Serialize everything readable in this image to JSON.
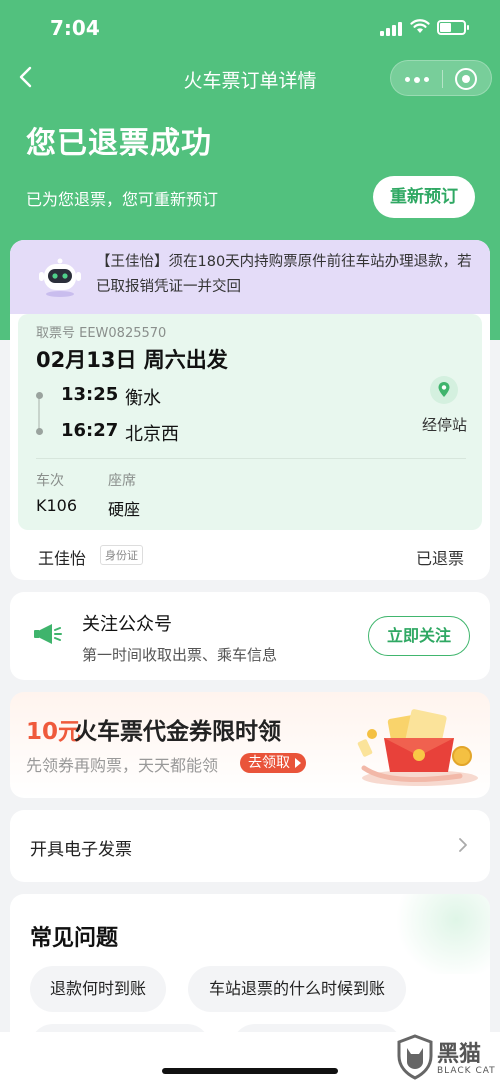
{
  "status_bar": {
    "time": "7:04"
  },
  "nav": {
    "title": "火车票订单详情"
  },
  "hero": {
    "headline": "您已退票成功",
    "subline": "已为您退票，您可重新预订",
    "rebook_label": "重新预订"
  },
  "notice": {
    "text": "【王佳怡】须在180天内持购票原件前往车站办理退款，若已取报销凭证一并交回"
  },
  "ticket": {
    "pickup_no": "取票号 EEW0825570",
    "depart_date": "02月13日 周六出发",
    "dep_time": "13:25",
    "dep_station": "衡水",
    "arr_time": "16:27",
    "arr_station": "北京西",
    "stops_label": "经停站",
    "train_header": "车次",
    "seat_header": "座席",
    "train_no": "K106",
    "seat_type": "硬座",
    "passenger": "王佳怡",
    "id_type": "身份证",
    "status": "已退票"
  },
  "follow": {
    "title": "关注公众号",
    "subtitle": "第一时间收取出票、乘车信息",
    "button": "立即关注"
  },
  "coupon": {
    "amount": "10元",
    "title": "火车票代金券限时领",
    "subtitle": "先领券再购票，天天都能领",
    "claim_label": "去领取"
  },
  "invoice": {
    "label": "开具电子发票"
  },
  "faq": {
    "title": "常见问题",
    "chips": [
      "退款何时到账",
      "车站退票的什么时候到账"
    ]
  },
  "watermark": {
    "cn": "黑猫",
    "en": "BLACK CAT"
  },
  "colors": {
    "brand_green": "#52c17e",
    "accent_red": "#ef5a3c",
    "notice_purple": "#e4dcf8"
  }
}
